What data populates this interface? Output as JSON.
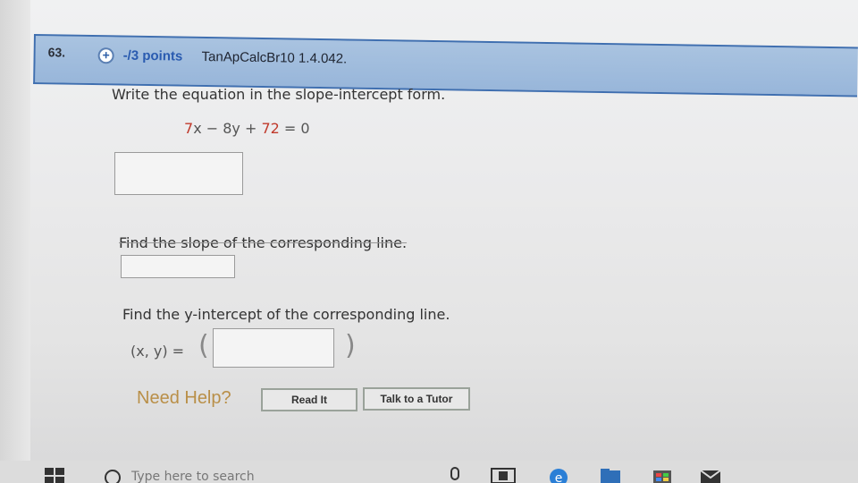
{
  "question": {
    "number": "63.",
    "points": "-/3 points",
    "source": "TanApCalcBr10 1.4.042."
  },
  "part1": {
    "prompt": "Write the equation in the slope-intercept form.",
    "eq_a": "7",
    "eq_b": "x − 8y + ",
    "eq_c": "72",
    "eq_d": " = 0"
  },
  "part2": {
    "prompt": "Find the slope of the corresponding line."
  },
  "part3": {
    "prompt": "Find the y-intercept of the corresponding line.",
    "label": "(x, y) =",
    "open_paren": "(",
    "close_paren": ")"
  },
  "help": {
    "label": "Need Help?",
    "read_it": "Read It",
    "talk_tutor": "Talk to a Tutor"
  },
  "taskbar": {
    "search_placeholder": "Type here to search"
  },
  "colors": {
    "header_bg": "#98b6da",
    "points": "#2a5bb0",
    "equation_red": "#c0392b",
    "help": "#b98f48"
  }
}
